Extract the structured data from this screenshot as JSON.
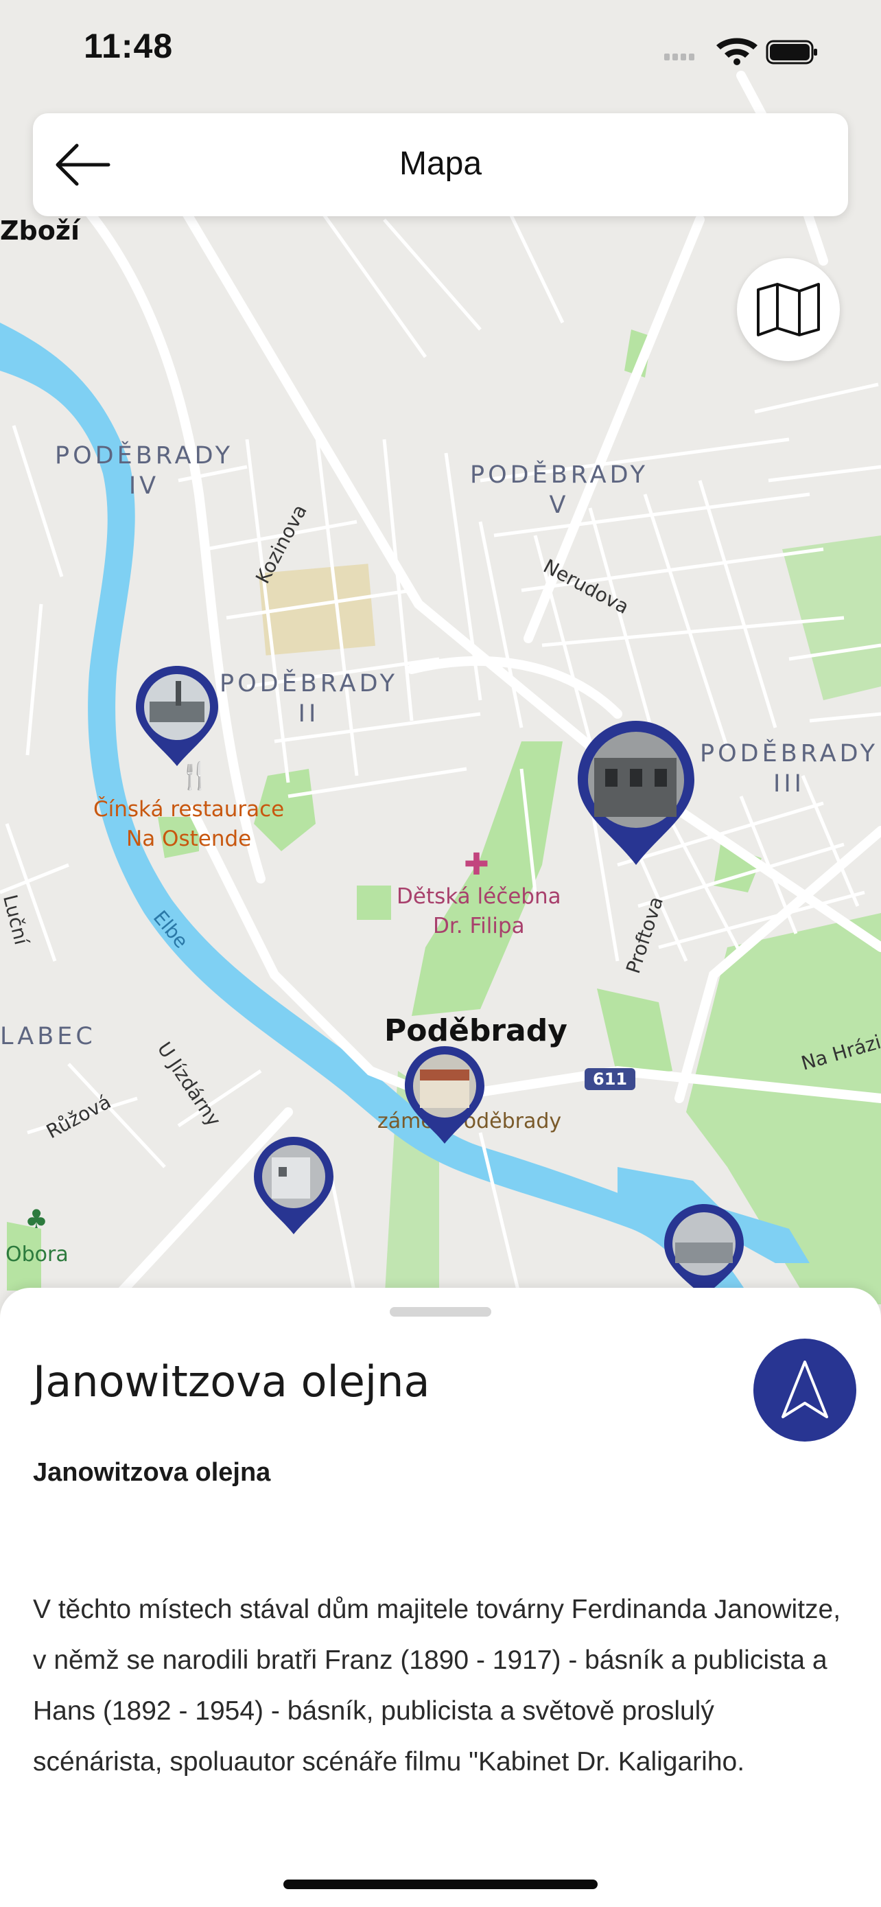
{
  "status_bar": {
    "time": "11:48"
  },
  "header": {
    "title": "Mapa"
  },
  "map": {
    "labels": {
      "zbozi": "Zboží",
      "podebrady_iv": "PODĚBRADY\nIV",
      "podebrady_v": "PODĚBRADY\nV",
      "podebrady_ii": "PODĚBRADY\nII",
      "podebrady_iii": "PODĚBRADY\nIII",
      "kozinova": "Kozinova",
      "nerudova": "Nerudova",
      "restaurant": "Čínská restaurace\nNa Ostende",
      "hospital": "Dětská léčebna\nDr. Filipa",
      "lucni": "Luční",
      "elbe": "Elbe",
      "proftova": "Proftova",
      "labec": "LABEC",
      "city": "Poděbrady",
      "road_number": "611",
      "na_hrazi": "Na Hrázi",
      "u_jizdarny": "U Jízdárny",
      "ruzova": "Růžová",
      "zamek": "zámek Poděbrady",
      "obora": "Obora"
    },
    "colors": {
      "water": "#7fd0f3",
      "park": "#b6e3a2",
      "marker": "#283592",
      "background": "#ecebe8"
    }
  },
  "sheet": {
    "title": "Janowitzova olejna",
    "subtitle": "Janowitzova olejna",
    "body": "V těchto místech stával dům majitele továrny Ferdinanda Janowitze, v němž se narodili bratři Franz (1890 - 1917) - básník a publicista a Hans (1892 - 1954) - básník, publicista a světově proslulý scénárista, spoluautor scénáře filmu \"Kabinet Dr. Kaligariho."
  },
  "icons": {
    "back": "arrow-left-icon",
    "layers": "map-icon",
    "navigate": "navigation-arrow-icon",
    "signal": "cellular-signal-icon",
    "wifi": "wifi-icon",
    "battery": "battery-icon",
    "restaurant": "fork-knife-icon",
    "hospital": "medical-cross-icon",
    "tree": "tree-icon"
  }
}
